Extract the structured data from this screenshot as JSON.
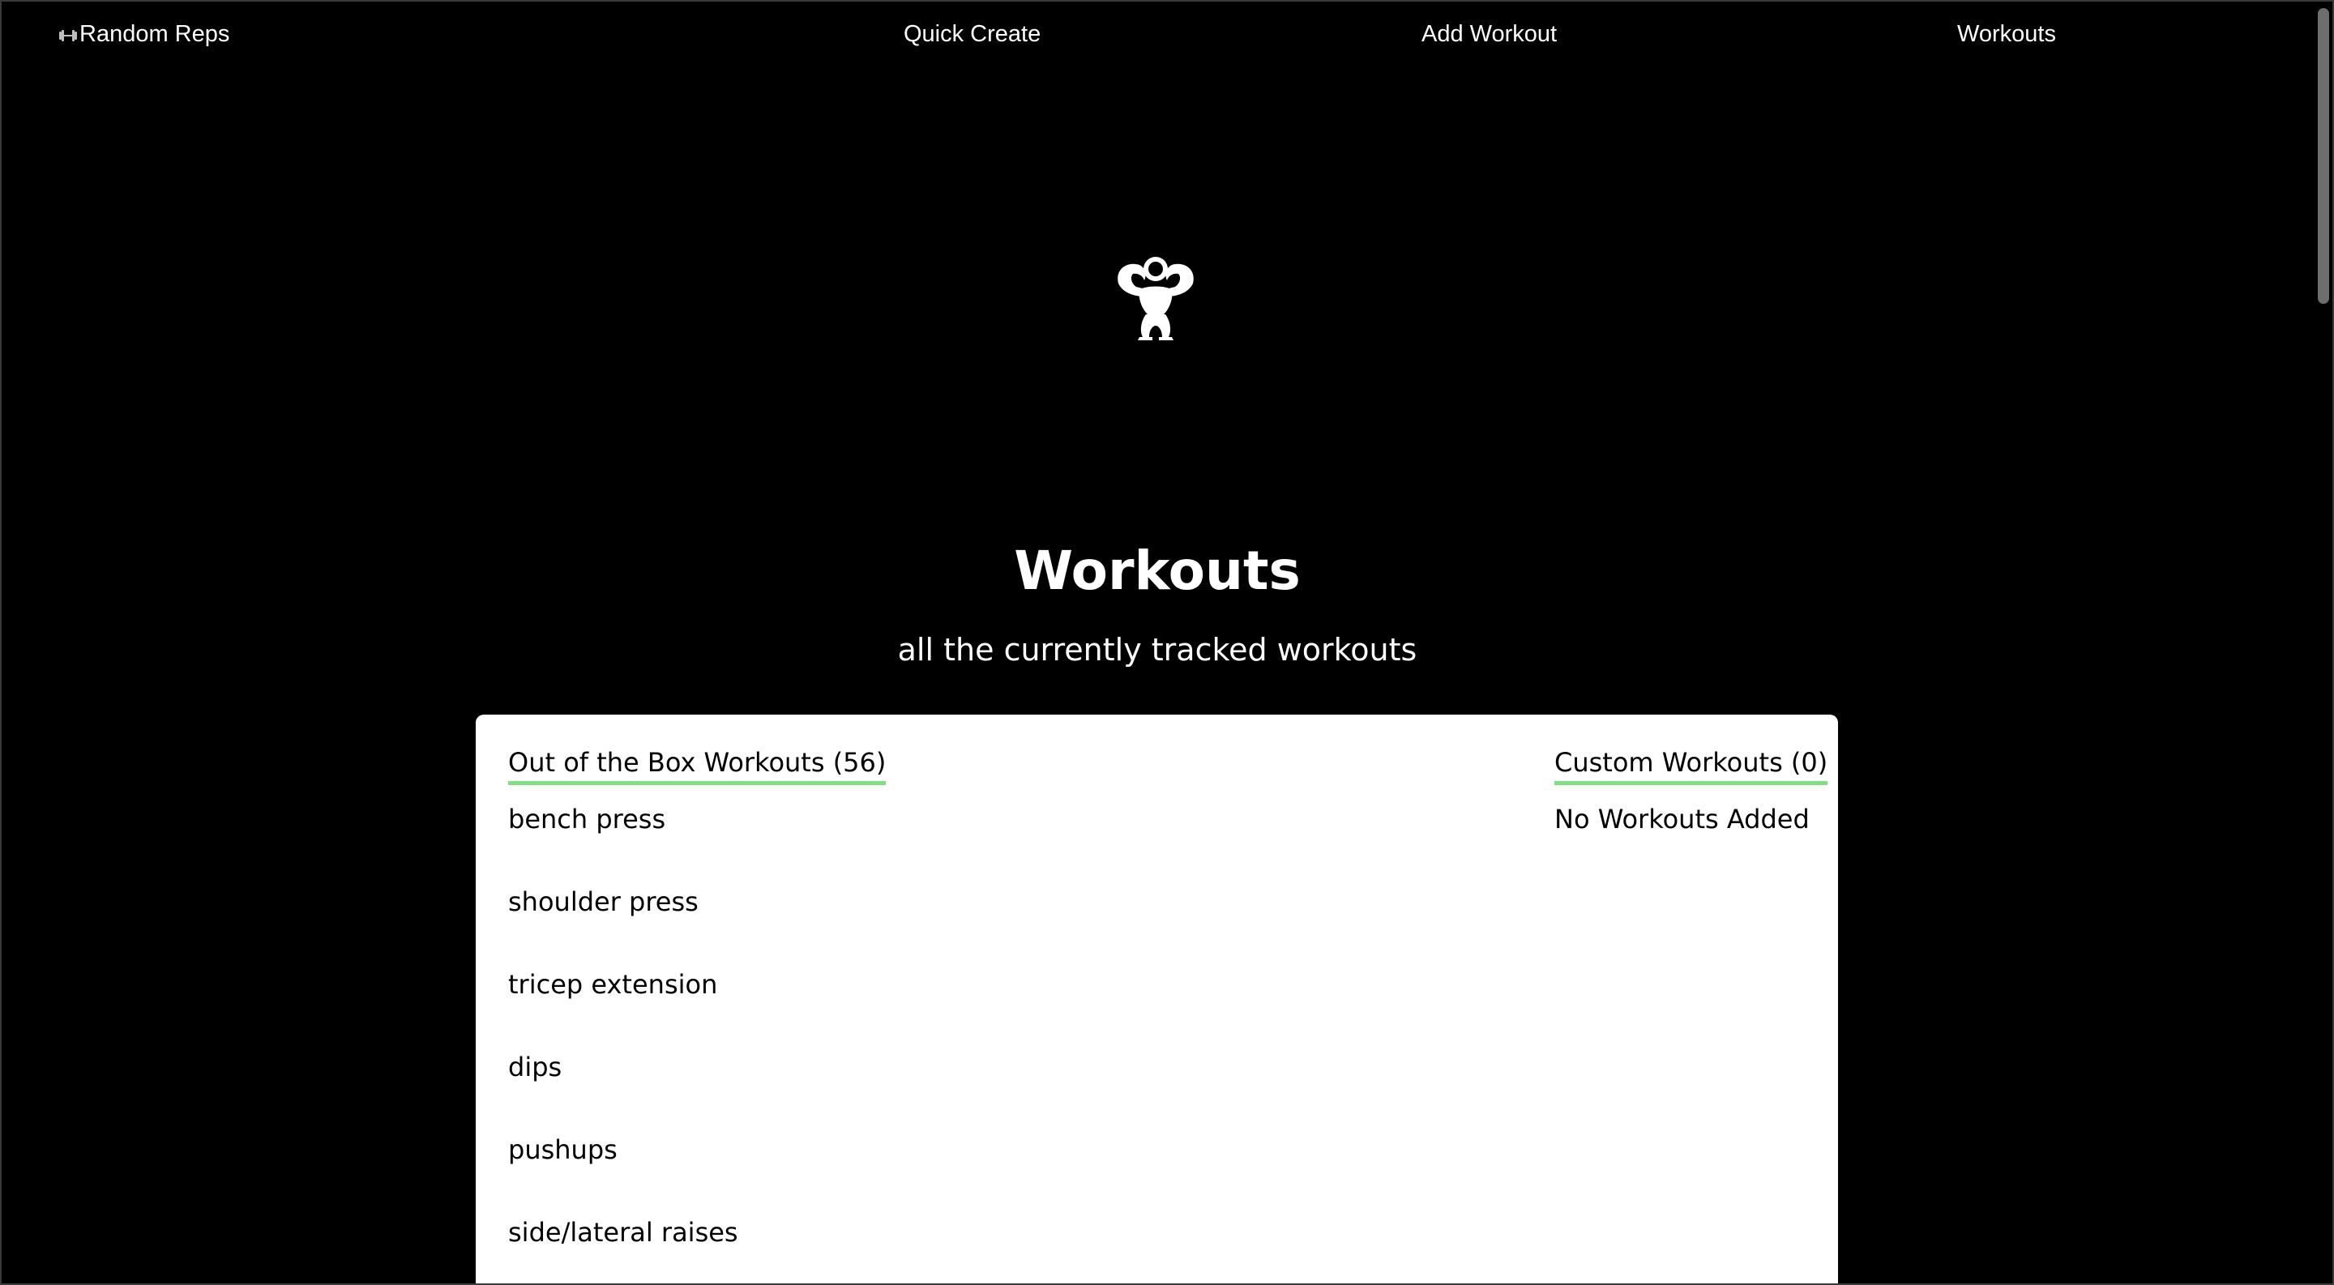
{
  "nav": {
    "brand": "Random Reps",
    "brand_icon": "dumbbell-icon",
    "links": {
      "quick_create": "Quick Create",
      "add_workout": "Add Workout",
      "workouts": "Workouts"
    }
  },
  "hero": {
    "logo_icon": "strongman-icon",
    "title": "Workouts",
    "subtitle": "all the currently tracked workouts"
  },
  "workouts": {
    "out_of_box": {
      "heading": "Out of the Box Workouts (56)",
      "items": [
        "bench press",
        "shoulder press",
        "tricep extension",
        "dips",
        "pushups",
        "side/lateral raises"
      ]
    },
    "custom": {
      "heading": "Custom Workouts (0)",
      "empty_text": "No Workouts Added"
    }
  },
  "colors": {
    "background": "#000000",
    "card": "#ffffff",
    "underline_accent": "#7ee07e"
  }
}
